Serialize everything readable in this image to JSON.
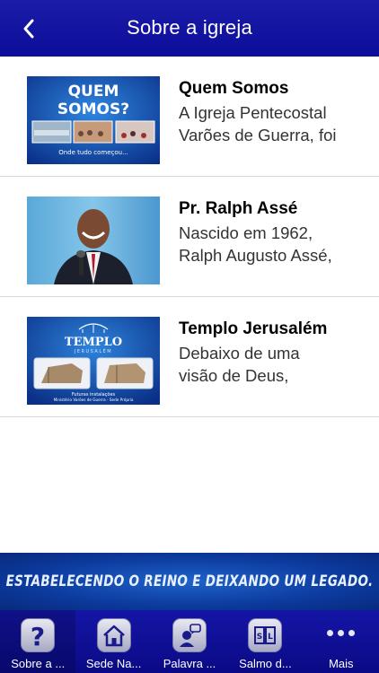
{
  "header": {
    "title": "Sobre a igreja",
    "back_icon": "chevron-left-icon"
  },
  "items": [
    {
      "title": "Quem Somos",
      "desc": [
        "A Igreja Pentecostal",
        "Varões de Guerra, foi"
      ],
      "thumb": {
        "big_line1": "QUEM",
        "big_line2": "SOMOS?",
        "caption": "Onde tudo começou..."
      }
    },
    {
      "title": "Pr. Ralph Assé",
      "desc": [
        "Nascido em 1962,",
        "Ralph Augusto Assé,"
      ],
      "thumb": {}
    },
    {
      "title": "Templo Jerusalém",
      "desc": [
        "Debaixo de uma",
        "visão de Deus,"
      ],
      "thumb": {
        "big": "TEMPLO",
        "sub": "JERUSALÉM",
        "caption1": "Futuras instalações",
        "caption2": "Ministério Varões de Guerra - Sede Própria"
      }
    }
  ],
  "banner": {
    "text": "ESTABELECENDO O REINO E DEIXANDO UM LEGADO."
  },
  "tabs": [
    {
      "label": "Sobre a ...",
      "icon": "question-icon",
      "active": true
    },
    {
      "label": "Sede Na...",
      "icon": "home-icon",
      "active": false
    },
    {
      "label": "Palavra ...",
      "icon": "speaker-icon",
      "active": false
    },
    {
      "label": "Salmo d...",
      "icon": "book-icon",
      "active": false
    },
    {
      "label": "Mais",
      "icon": "more-dots-icon",
      "active": false
    }
  ],
  "colors": {
    "nav": "#1414a0",
    "accent": "#0c3a9e"
  }
}
